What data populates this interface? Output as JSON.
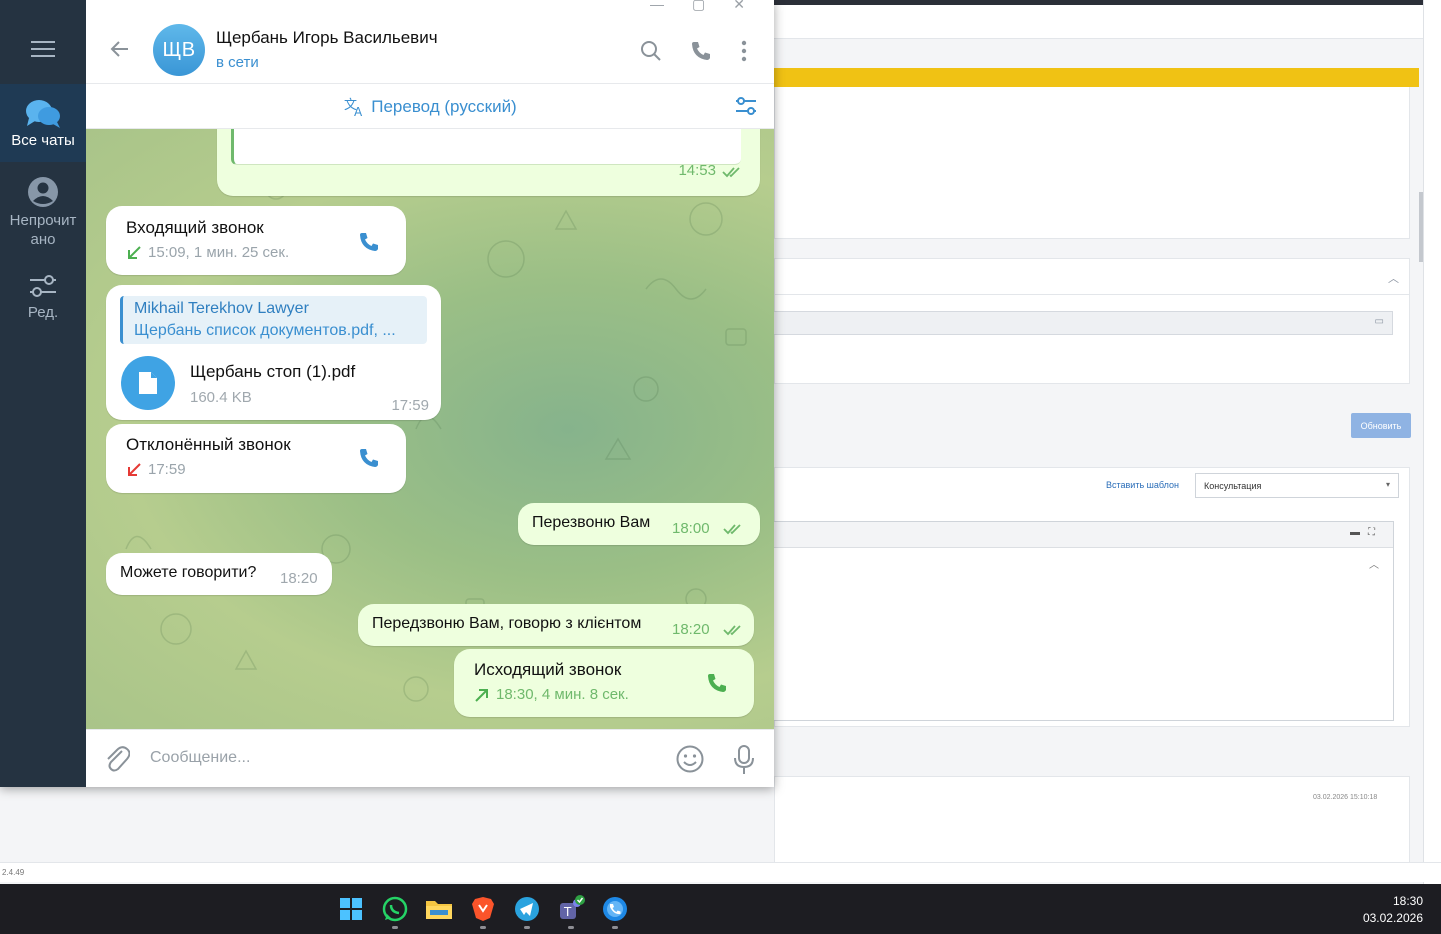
{
  "telegram": {
    "sidebar": {
      "items": [
        {
          "label": "Все чаты",
          "active": true
        },
        {
          "label": "Непрочитано",
          "line1": "Непрочит",
          "line2": "ано",
          "active": false
        },
        {
          "label": "Ред.",
          "active": false
        }
      ]
    },
    "header": {
      "avatar_initials": "ЩВ",
      "name": "Щербань Игорь Васильевич",
      "status": "в сети"
    },
    "translate_bar": {
      "label": "Перевод (русский)"
    },
    "messages": [
      {
        "type": "partial_out",
        "time": "14:53",
        "read": true
      },
      {
        "type": "call_in",
        "title": "Входящий звонок",
        "details": "15:09, 1 мин. 25 сек."
      },
      {
        "type": "file_in",
        "reply_author": "Mikhail Terekhov Lawyer",
        "reply_text": "Щербань список документов.pdf, ...",
        "file_name": "Щербань стоп (1).pdf",
        "file_size": "160.4 KB",
        "time": "17:59"
      },
      {
        "type": "call_declined",
        "title": "Отклонённый звонок",
        "details": "17:59"
      },
      {
        "type": "text_out",
        "text": "Перезвоню Вам",
        "time": "18:00",
        "read": true
      },
      {
        "type": "text_in",
        "text": "Можете говорити?",
        "time": "18:20"
      },
      {
        "type": "text_out",
        "text": "Передзвоню Вам, говорю з клієнтом",
        "time": "18:20",
        "read": true
      },
      {
        "type": "call_out",
        "title": "Исходящий звонок",
        "details": "18:30, 4 мин. 8 сек."
      }
    ],
    "composer": {
      "placeholder": "Сообщение..."
    },
    "colors": {
      "accent": "#3a8fd0",
      "sidebar_bg": "#253341",
      "out_bubble": "#eeffde",
      "call_green": "#4caf50",
      "call_red": "#e53935"
    }
  },
  "crm": {
    "update_button": "Обновить",
    "insert_template_link": "Вставить шаблон",
    "template_select_value": "Консультация",
    "timestamp": "03.02.2026 15:10:18",
    "version": "2.4.49",
    "highlight_color": "#f0c214"
  },
  "taskbar": {
    "apps": [
      "windows-start",
      "whatsapp",
      "file-explorer",
      "brave",
      "telegram",
      "teams",
      "phone"
    ],
    "time": "18:30",
    "date": "03.02.2026"
  }
}
